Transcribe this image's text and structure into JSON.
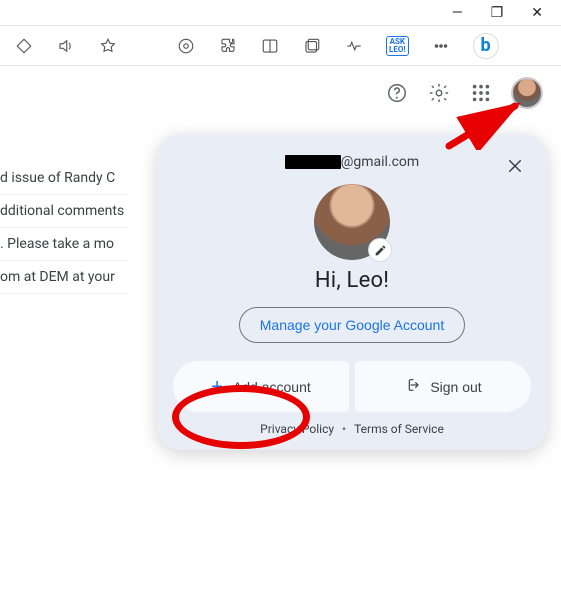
{
  "window": {
    "min": "—",
    "max": "❐",
    "close": "✕"
  },
  "toolbar": {
    "ask_leo_line1": "ASK",
    "ask_leo_line2": "LEO!"
  },
  "bg_lines": {
    "l1": "d issue of Randy C",
    "l2": "dditional comments",
    "l3": ". Please take a mo",
    "l4": "om at DEM at your"
  },
  "card": {
    "email_suffix": "@gmail.com",
    "greeting": "Hi, Leo!",
    "manage": "Manage your Google Account",
    "add_account": "Add account",
    "sign_out": "Sign out",
    "privacy": "Privacy Policy",
    "terms": "Terms of Service"
  }
}
